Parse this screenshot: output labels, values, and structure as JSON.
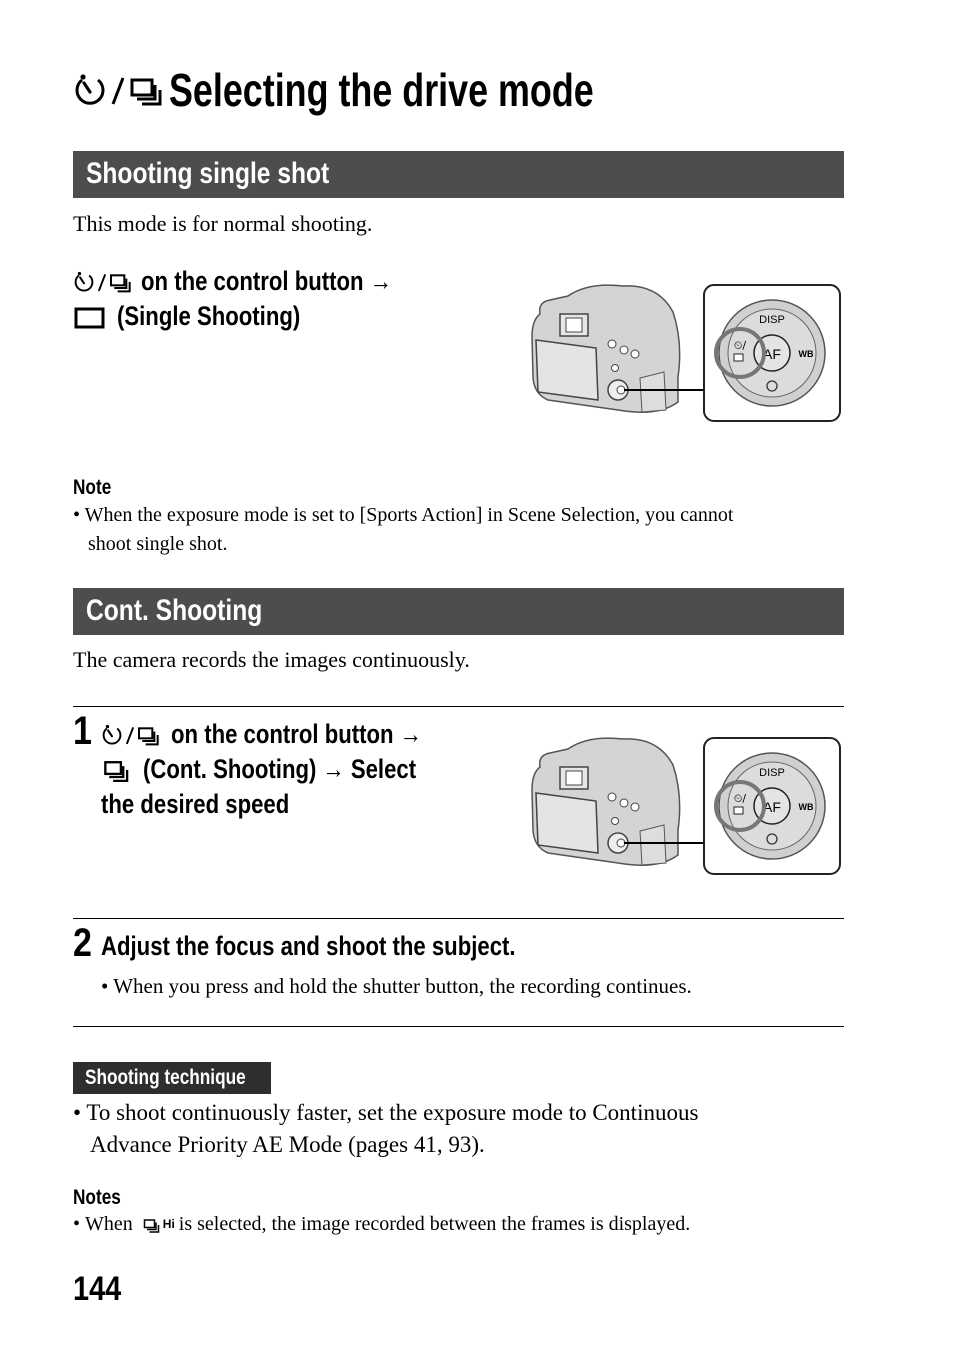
{
  "page": {
    "title": "Selecting the drive mode",
    "title_icons": [
      "self-timer-icon",
      "continuous-shooting-icon"
    ],
    "page_number": "144"
  },
  "section_single": {
    "header": "Shooting single shot",
    "intro": "This mode is for normal shooting.",
    "instruction_line1": "on the control button",
    "instruction_line2": "(Single Shooting)",
    "note_label": "Note",
    "note_bullet": "•",
    "note_text_line1": "When the exposure mode is set to [Sports Action] in Scene Selection, you cannot",
    "note_text_line2": "shoot single shot."
  },
  "section_cont": {
    "header": "Cont. Shooting",
    "intro": "The camera records the images continuously.",
    "step1": {
      "number": "1",
      "line1": "on the control button",
      "line2_a": "(Cont. Shooting)",
      "line2_b": "Select",
      "line3": "the desired speed"
    },
    "step2": {
      "number": "2",
      "title": "Adjust the focus and shoot the subject.",
      "bullet": "•",
      "text": "When you press and hold the shutter button, the recording continues."
    },
    "technique": {
      "badge": "Shooting technique",
      "bullet": "•",
      "line1": "To shoot continuously faster, set the exposure mode to Continuous",
      "line2": "Advance Priority AE Mode (pages 41, 93)."
    },
    "notes": {
      "label": "Notes",
      "bullet": "•",
      "text_before": "When",
      "icon_label": "Hi",
      "text_after": "is selected, the image recorded between the frames is displayed."
    }
  },
  "arrow": "→",
  "illustration": {
    "dial_labels": {
      "top": "DISP",
      "center": "AF",
      "right": "WB"
    }
  },
  "colors": {
    "section_header_bg": "#4d4d4d",
    "badge_bg": "#2e2e2e",
    "text": "#000000"
  }
}
